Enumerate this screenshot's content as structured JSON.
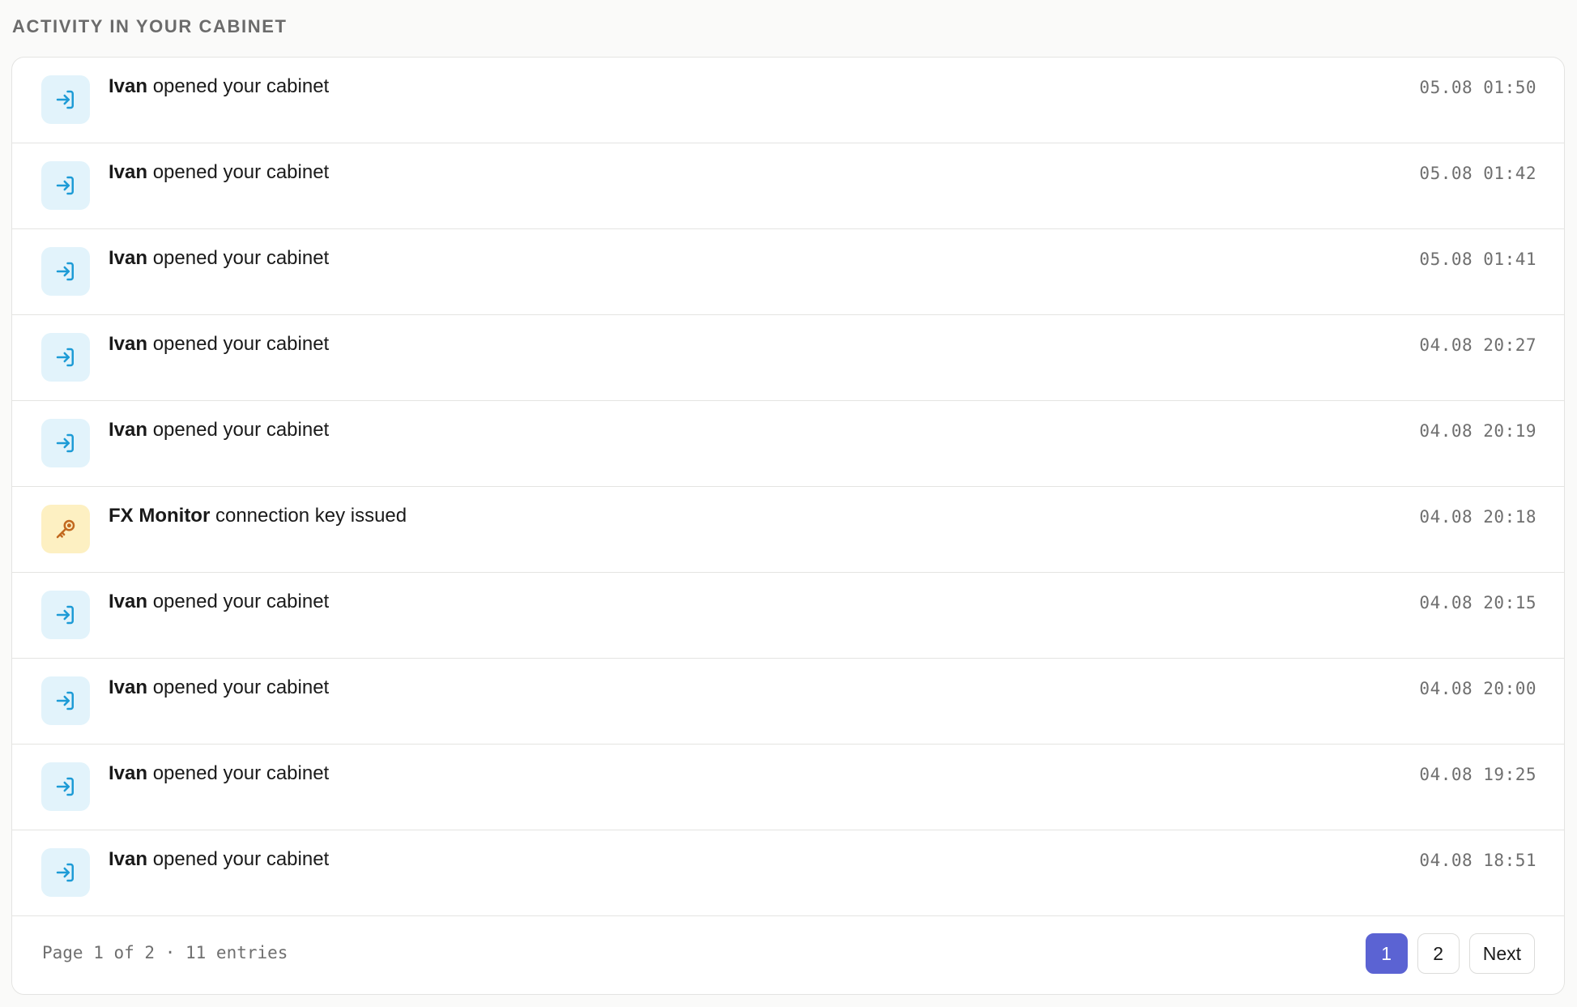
{
  "section_title": "ACTIVITY IN YOUR CABINET",
  "colors": {
    "login_icon_bg": "#e2f3fb",
    "login_icon_fg": "#1d9bd6",
    "key_icon_bg": "#fdf0c2",
    "key_icon_fg": "#c2691f",
    "active_page": "#5b63d3"
  },
  "activity": [
    {
      "icon": "login-icon",
      "actor": "Ivan",
      "action": "opened your cabinet",
      "time": "05.08 01:50"
    },
    {
      "icon": "login-icon",
      "actor": "Ivan",
      "action": "opened your cabinet",
      "time": "05.08 01:42"
    },
    {
      "icon": "login-icon",
      "actor": "Ivan",
      "action": "opened your cabinet",
      "time": "05.08 01:41"
    },
    {
      "icon": "login-icon",
      "actor": "Ivan",
      "action": "opened your cabinet",
      "time": "04.08 20:27"
    },
    {
      "icon": "login-icon",
      "actor": "Ivan",
      "action": "opened your cabinet",
      "time": "04.08 20:19"
    },
    {
      "icon": "key-icon",
      "actor": "FX Monitor",
      "action": "connection key issued",
      "time": "04.08 20:18"
    },
    {
      "icon": "login-icon",
      "actor": "Ivan",
      "action": "opened your cabinet",
      "time": "04.08 20:15"
    },
    {
      "icon": "login-icon",
      "actor": "Ivan",
      "action": "opened your cabinet",
      "time": "04.08 20:00"
    },
    {
      "icon": "login-icon",
      "actor": "Ivan",
      "action": "opened your cabinet",
      "time": "04.08 19:25"
    },
    {
      "icon": "login-icon",
      "actor": "Ivan",
      "action": "opened your cabinet",
      "time": "04.08 18:51"
    }
  ],
  "pagination": {
    "info": "Page 1 of 2 · 11 entries",
    "pages": [
      "1",
      "2"
    ],
    "current": "1",
    "next_label": "Next"
  }
}
